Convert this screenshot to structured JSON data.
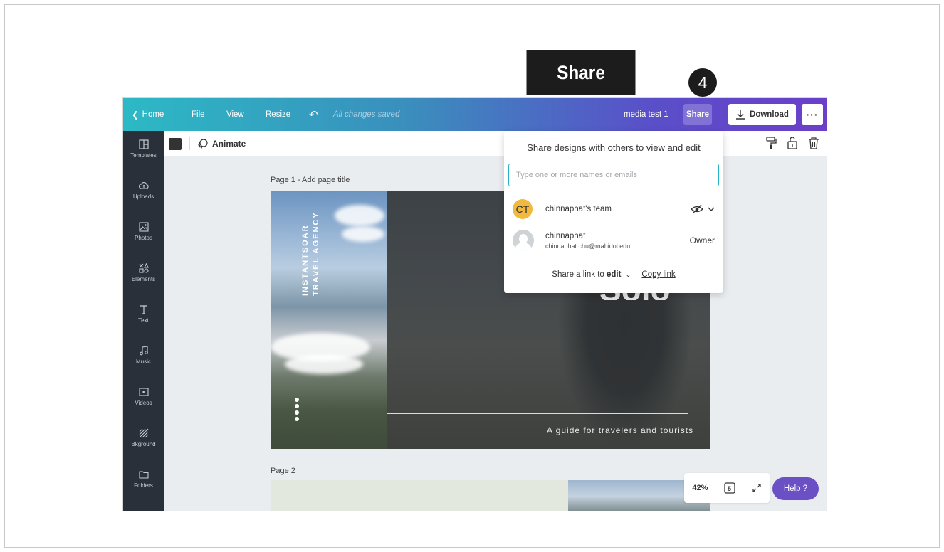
{
  "callout": {
    "label": "Share",
    "step": "4"
  },
  "topbar": {
    "home": "Home",
    "file": "File",
    "view": "View",
    "resize": "Resize",
    "saved_status": "All changes saved",
    "doc_title": "media test 1",
    "share": "Share",
    "download": "Download",
    "more": "···"
  },
  "sidebar": {
    "items": [
      {
        "label": "Templates",
        "icon": "templates-icon"
      },
      {
        "label": "Uploads",
        "icon": "upload-cloud-icon"
      },
      {
        "label": "Photos",
        "icon": "photos-icon"
      },
      {
        "label": "Elements",
        "icon": "elements-icon"
      },
      {
        "label": "Text",
        "icon": "text-icon"
      },
      {
        "label": "Music",
        "icon": "music-icon"
      },
      {
        "label": "Videos",
        "icon": "videos-icon"
      },
      {
        "label": "Bkground",
        "icon": "background-icon"
      },
      {
        "label": "Folders",
        "icon": "folder-icon"
      }
    ]
  },
  "toolbar": {
    "animate": "Animate"
  },
  "canvas": {
    "page1_title": "Page 1 - Add page title",
    "page2_title": "Page 2",
    "design": {
      "vertical_line1": "INSTANTSOAR",
      "vertical_line2": "TRAVEL AGENCY",
      "big_text": "Solo",
      "guide": "A guide for travelers and tourists"
    }
  },
  "zoom": {
    "level": "42%"
  },
  "help": "Help ?",
  "share_panel": {
    "title": "Share designs with others to view and edit",
    "input_placeholder": "Type one or more names or emails",
    "team": {
      "avatar": "CT",
      "name": "chinnaphat's team"
    },
    "owner": {
      "name": "chinnaphat",
      "email": "chinnaphat.chu@mahidol.edu",
      "role": "Owner"
    },
    "link_prefix": "Share a link to",
    "link_mode": "edit",
    "copy_link": "Copy link"
  },
  "colors": {
    "accent_teal": "#2cb9c5",
    "accent_purple": "#6b3fc9",
    "avatar_ct": "#f1b93d"
  }
}
